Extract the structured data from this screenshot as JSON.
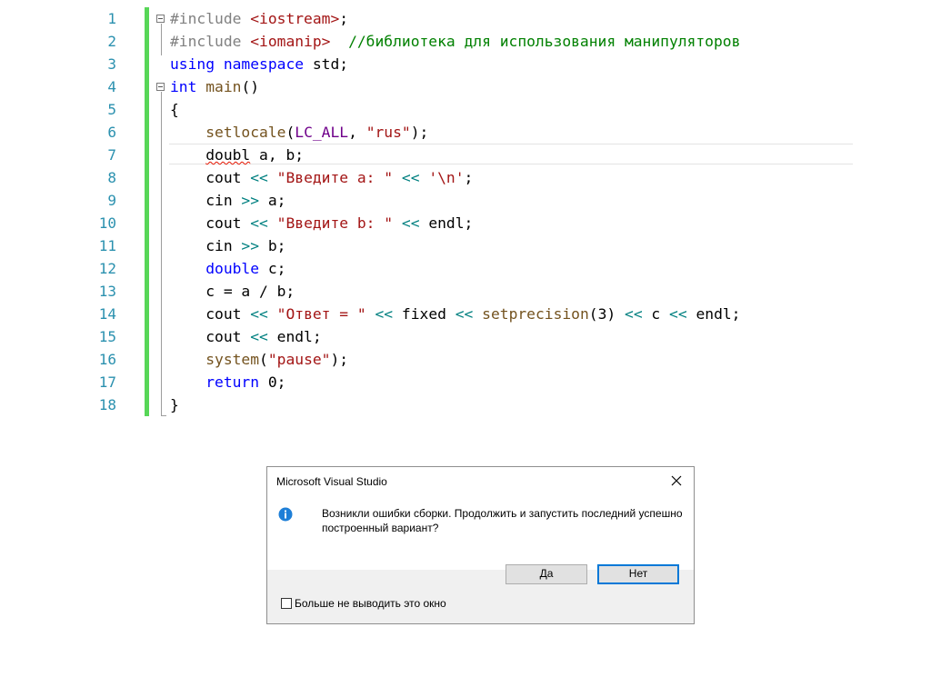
{
  "editor": {
    "line_numbers": [
      "1",
      "2",
      "3",
      "4",
      "5",
      "6",
      "7",
      "8",
      "9",
      "10",
      "11",
      "12",
      "13",
      "14",
      "15",
      "16",
      "17",
      "18"
    ],
    "lines": [
      [
        {
          "t": "#include ",
          "c": "pp"
        },
        {
          "t": "<iostream>",
          "c": "inc"
        },
        {
          "t": ";",
          "c": ""
        }
      ],
      [
        {
          "t": "#include ",
          "c": "pp"
        },
        {
          "t": "<iomanip>",
          "c": "inc"
        },
        {
          "t": "  ",
          "c": ""
        },
        {
          "t": "//библиотека для использования манипуляторов",
          "c": "cm"
        }
      ],
      [
        {
          "t": "using",
          "c": "kw"
        },
        {
          "t": " ",
          "c": ""
        },
        {
          "t": "namespace",
          "c": "kw"
        },
        {
          "t": " std;",
          "c": ""
        }
      ],
      [
        {
          "t": "int",
          "c": "kw"
        },
        {
          "t": " ",
          "c": ""
        },
        {
          "t": "main",
          "c": "fn"
        },
        {
          "t": "()",
          "c": ""
        }
      ],
      [
        {
          "t": "{",
          "c": ""
        }
      ],
      [
        {
          "t": "    ",
          "c": ""
        },
        {
          "t": "setlocale",
          "c": "fn"
        },
        {
          "t": "(",
          "c": ""
        },
        {
          "t": "LC_ALL",
          "c": "mac"
        },
        {
          "t": ", ",
          "c": ""
        },
        {
          "t": "\"rus\"",
          "c": "str"
        },
        {
          "t": ");",
          "c": ""
        }
      ],
      [
        {
          "t": "    ",
          "c": ""
        },
        {
          "t": "doubl",
          "c": "err"
        },
        {
          "t": " a, b;",
          "c": ""
        }
      ],
      [
        {
          "t": "    cout ",
          "c": ""
        },
        {
          "t": "<<",
          "c": "op"
        },
        {
          "t": " ",
          "c": ""
        },
        {
          "t": "\"Введите a: \"",
          "c": "str"
        },
        {
          "t": " ",
          "c": ""
        },
        {
          "t": "<<",
          "c": "op"
        },
        {
          "t": " ",
          "c": ""
        },
        {
          "t": "'\\n'",
          "c": "str"
        },
        {
          "t": ";",
          "c": ""
        }
      ],
      [
        {
          "t": "    cin ",
          "c": ""
        },
        {
          "t": ">>",
          "c": "op"
        },
        {
          "t": " a;",
          "c": ""
        }
      ],
      [
        {
          "t": "    cout ",
          "c": ""
        },
        {
          "t": "<<",
          "c": "op"
        },
        {
          "t": " ",
          "c": ""
        },
        {
          "t": "\"Введите b: \"",
          "c": "str"
        },
        {
          "t": " ",
          "c": ""
        },
        {
          "t": "<<",
          "c": "op"
        },
        {
          "t": " endl;",
          "c": ""
        }
      ],
      [
        {
          "t": "    cin ",
          "c": ""
        },
        {
          "t": ">>",
          "c": "op"
        },
        {
          "t": " b;",
          "c": ""
        }
      ],
      [
        {
          "t": "    ",
          "c": ""
        },
        {
          "t": "double",
          "c": "kw"
        },
        {
          "t": " c;",
          "c": ""
        }
      ],
      [
        {
          "t": "    c = a / b;",
          "c": ""
        }
      ],
      [
        {
          "t": "    cout ",
          "c": ""
        },
        {
          "t": "<<",
          "c": "op"
        },
        {
          "t": " ",
          "c": ""
        },
        {
          "t": "\"Ответ = \"",
          "c": "str"
        },
        {
          "t": " ",
          "c": ""
        },
        {
          "t": "<<",
          "c": "op"
        },
        {
          "t": " fixed ",
          "c": ""
        },
        {
          "t": "<<",
          "c": "op"
        },
        {
          "t": " ",
          "c": ""
        },
        {
          "t": "setprecision",
          "c": "fn"
        },
        {
          "t": "(3) ",
          "c": ""
        },
        {
          "t": "<<",
          "c": "op"
        },
        {
          "t": " c ",
          "c": ""
        },
        {
          "t": "<<",
          "c": "op"
        },
        {
          "t": " endl;",
          "c": ""
        }
      ],
      [
        {
          "t": "    cout ",
          "c": ""
        },
        {
          "t": "<<",
          "c": "op"
        },
        {
          "t": " endl;",
          "c": ""
        }
      ],
      [
        {
          "t": "    ",
          "c": ""
        },
        {
          "t": "system",
          "c": "fn"
        },
        {
          "t": "(",
          "c": ""
        },
        {
          "t": "\"pause\"",
          "c": "str"
        },
        {
          "t": ");",
          "c": ""
        }
      ],
      [
        {
          "t": "    ",
          "c": ""
        },
        {
          "t": "return",
          "c": "kw"
        },
        {
          "t": " 0;",
          "c": ""
        }
      ],
      [
        {
          "t": "}",
          "c": ""
        }
      ]
    ],
    "colors": {
      "line_number": "#2b91af",
      "keyword": "#0000ff",
      "preprocessor": "#808080",
      "string": "#a31515",
      "comment": "#008000",
      "macro": "#6f008a",
      "operator": "#008080",
      "change_bar": "#57d657",
      "error_squiggle": "#e51400"
    }
  },
  "dialog": {
    "title": "Microsoft Visual Studio",
    "message": "Возникли ошибки сборки. Продолжить и запустить последний успешно построенный вариант?",
    "yes_label": "Да",
    "no_label": "Нет",
    "checkbox_label": "Больше не выводить это окно",
    "checkbox_checked": false,
    "icon": "info-icon",
    "close_icon": "close-icon"
  }
}
